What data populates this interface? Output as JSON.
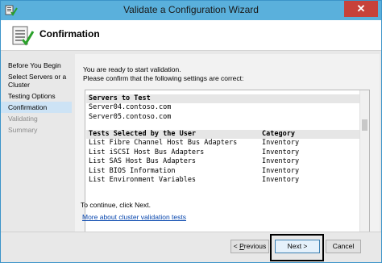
{
  "window": {
    "title": "Validate a Configuration Wizard",
    "close_label": "✕"
  },
  "header": {
    "title": "Confirmation"
  },
  "nav": {
    "items": [
      {
        "label": "Before You Begin",
        "state": "normal"
      },
      {
        "label": "Select Servers or a Cluster",
        "state": "normal"
      },
      {
        "label": "Testing Options",
        "state": "normal"
      },
      {
        "label": "Confirmation",
        "state": "active"
      },
      {
        "label": "Validating",
        "state": "disabled"
      },
      {
        "label": "Summary",
        "state": "disabled"
      }
    ]
  },
  "main": {
    "intro_line1": "You are ready to start validation.",
    "intro_line2": "Please confirm that the following settings are correct:",
    "servers_header": "Servers to Test",
    "servers": [
      "Server04.contoso.com",
      "Server05.contoso.com"
    ],
    "tests_header": "Tests Selected by the User",
    "category_header": "Category",
    "tests": [
      {
        "name": "List Fibre Channel Host Bus Adapters",
        "category": "Inventory"
      },
      {
        "name": "List iSCSI Host Bus Adapters",
        "category": "Inventory"
      },
      {
        "name": "List SAS Host Bus Adapters",
        "category": "Inventory"
      },
      {
        "name": "List BIOS Information",
        "category": "Inventory"
      },
      {
        "name": "List Environment Variables",
        "category": "Inventory"
      }
    ],
    "continue_text": "To continue, click Next.",
    "more_link": "More about cluster validation tests"
  },
  "footer": {
    "prev_prefix": "< ",
    "prev_accel": "P",
    "prev_rest": "revious",
    "next_label": "Next >",
    "cancel_label": "Cancel"
  },
  "colors": {
    "titlebar": "#5ab0dc",
    "close": "#c7423a",
    "nav_active": "#cde3f5",
    "link": "#0645ad"
  }
}
